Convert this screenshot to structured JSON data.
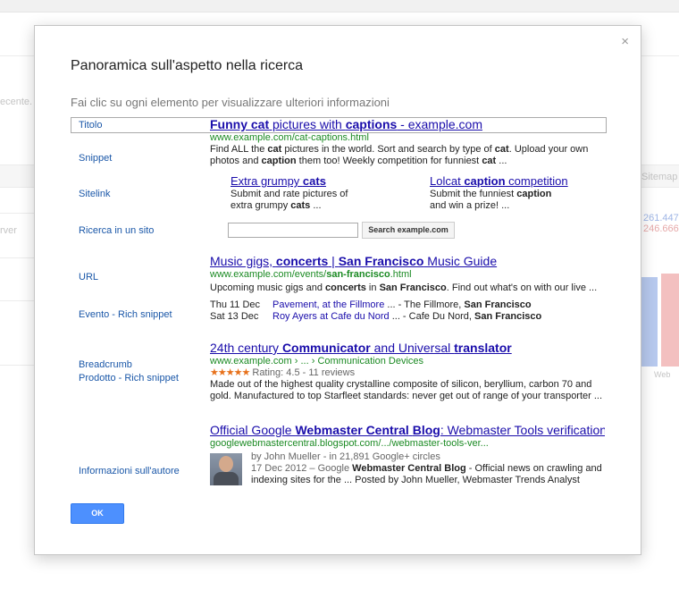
{
  "background": {
    "left_snippet": "ecente. V",
    "left_label": "rver",
    "right_header": "Sitemap",
    "right_value_1": "261.447",
    "right_value_2": "246.666",
    "right_axis": "Web"
  },
  "dialog": {
    "title": "Panoramica sull'aspetto nella ricerca",
    "subtitle": "Fai clic su ogni elemento per visualizzare ulteriori informazioni",
    "close_symbol": "×",
    "ok_label": "OK"
  },
  "labels": [
    "Titolo",
    "Snippet",
    "Sitelink",
    "Ricerca in un sito",
    "URL",
    "Evento - Rich snippet",
    "Breadcrumb",
    "Prodotto - Rich snippet",
    "Informazioni sull'autore"
  ],
  "result1": {
    "title_pre": "Funny cat",
    "title_mid": " pictures with ",
    "title_bold": "captions",
    "title_post": " - example.com",
    "url": "www.example.com/cat-captions.html",
    "snippet_a": "Find ALL the ",
    "snippet_b": "cat",
    "snippet_c": " pictures in the world. Sort and search by type of ",
    "snippet_d": "cat",
    "snippet_e": ". Upload your own photos and ",
    "snippet_f": "caption",
    "snippet_g": " them too! Weekly competition for funniest ",
    "snippet_h": "cat",
    "snippet_i": " ...",
    "sitelink1": {
      "title_a": "Extra grumpy ",
      "title_b": "cats",
      "desc_a": "Submit and rate pictures of",
      "desc_b": "extra grumpy ",
      "desc_c": "cats",
      "desc_d": " ..."
    },
    "sitelink2": {
      "title_a": "Lolcat ",
      "title_b": "caption",
      "title_c": " competition",
      "desc_a": "Submit the funniest ",
      "desc_b": "caption",
      "desc_c": "and win a prize! ..."
    },
    "search_button": "Search example.com"
  },
  "result2": {
    "title_a": "Music gigs, ",
    "title_b": "concerts",
    "title_c": " | ",
    "title_d": "San Francisco",
    "title_e": " Music Guide",
    "url_a": "www.example.com/events/",
    "url_b": "san-francisco",
    "url_c": ".html",
    "snippet_a": "Upcoming music gigs and ",
    "snippet_b": "concerts",
    "snippet_c": " in ",
    "snippet_d": "San Francisco",
    "snippet_e": ". Find out what's on with our live ...",
    "events": [
      {
        "date": "Thu 11 Dec",
        "link": "Pavement, at the Fillmore",
        "rest_a": " ... - The Fillmore, ",
        "rest_b": "San Francisco"
      },
      {
        "date": "Sat 13 Dec",
        "link": "Roy Ayers at Cafe du Nord",
        "rest_a": " ... - Cafe Du Nord, ",
        "rest_b": "San Francisco"
      }
    ]
  },
  "result3": {
    "title_a": "24th century ",
    "title_b": "Communicator",
    "title_c": " and Universal ",
    "title_d": "translator",
    "url_a": "www.example.com",
    "url_b": " › ... › ",
    "url_c": "Communication Devices",
    "stars": "★★★★★",
    "rating": " Rating: 4.5 - 11 reviews",
    "snippet": "Made out of the highest quality crystalline composite of silicon, beryllium, carbon 70 and gold. Manufactured to top Starfleet standards: never get out of range of your transporter ..."
  },
  "result4": {
    "title_a": "Official Google ",
    "title_b": "Webmaster Central",
    "title_c": " ",
    "title_d": "Blog",
    "title_e": ": Webmaster Tools verification...",
    "url": "googlewebmastercentral.blogspot.com/.../webmaster-tools-ver...",
    "author_a": "by John Mueller - in 21,891 Google+ circles",
    "snippet_a": "17 Dec 2012 – Google ",
    "snippet_b": "Webmaster Central Blog",
    "snippet_c": " - Official news on crawling and indexing  sites for the ... Posted by John Mueller, Webmaster Trends Analyst"
  }
}
